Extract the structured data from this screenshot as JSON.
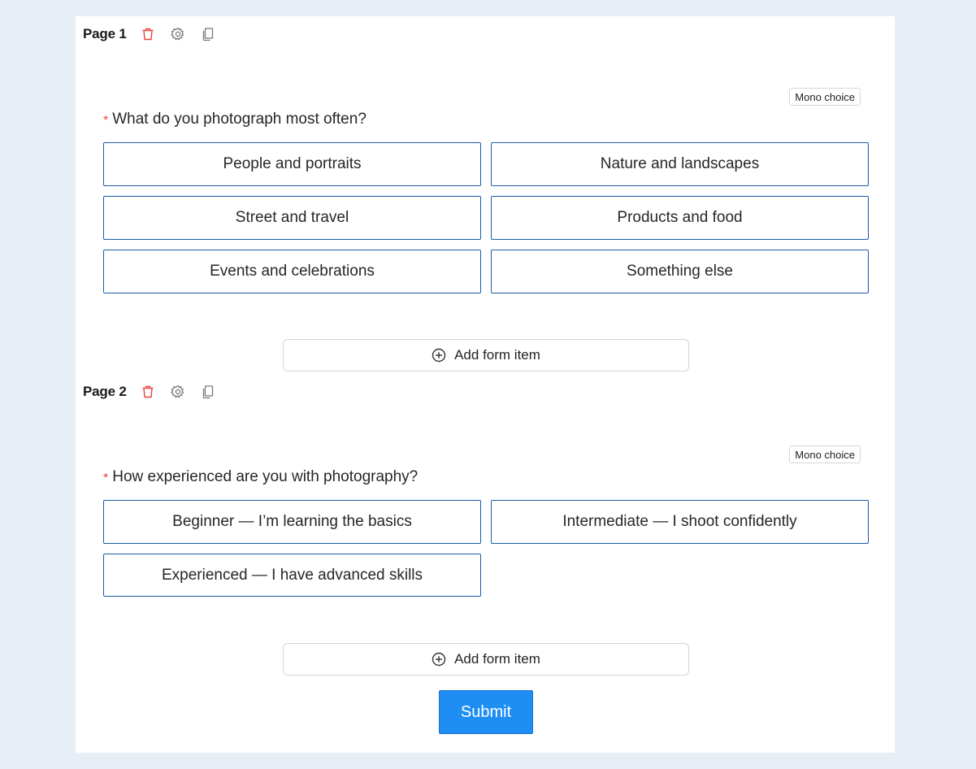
{
  "pages": [
    {
      "title": "Page 1",
      "badge": "Mono choice",
      "question": "What do you photograph most often?",
      "required_mark": "*",
      "choices": [
        "People and portraits",
        "Nature and landscapes",
        "Street and travel",
        "Products and food",
        "Events and celebrations",
        "Something else"
      ],
      "add_label": "Add form item"
    },
    {
      "title": "Page 2",
      "badge": "Mono choice",
      "question": "How experienced are you with photography?",
      "required_mark": "*",
      "choices": [
        "Beginner — I’m learning the basics",
        "Intermediate — I shoot confidently",
        "Experienced — I have advanced skills"
      ],
      "add_label": "Add form item"
    }
  ],
  "submit_label": "Submit",
  "icons": {
    "delete": "trash-icon",
    "settings": "gear-icon",
    "duplicate": "copy-icon",
    "add": "plus-circle-icon"
  },
  "colors": {
    "background": "#e8eef6",
    "choice_border": "#1a5ca8",
    "required": "#e8453c",
    "delete_icon": "#e8453c",
    "submit_bg": "#1e8ef5"
  }
}
